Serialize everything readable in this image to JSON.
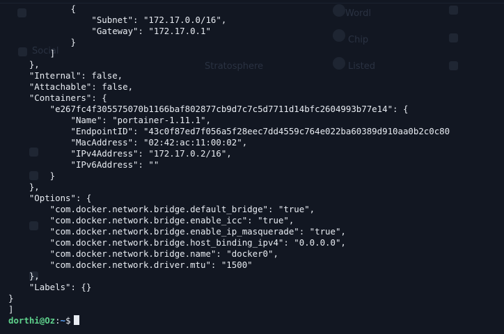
{
  "terminal": {
    "lines": [
      "            {",
      "                \"Subnet\": \"172.17.0.0/16\",",
      "                \"Gateway\": \"172.17.0.1\"",
      "            }",
      "        ]",
      "    },",
      "    \"Internal\": false,",
      "    \"Attachable\": false,",
      "    \"Containers\": {",
      "        \"e267fc4f305575070b1166baf802877cb9d7c7c5d7711d14bfc2604993b77e14\": {",
      "            \"Name\": \"portainer-1.11.1\",",
      "            \"EndpointID\": \"43c0f87ed7f056a5f28eec7dd4559c764e022ba60389d910aa0b2c0c80",
      "            \"MacAddress\": \"02:42:ac:11:00:02\",",
      "            \"IPv4Address\": \"172.17.0.2/16\",",
      "            \"IPv6Address\": \"\"",
      "        }",
      "    },",
      "    \"Options\": {",
      "        \"com.docker.network.bridge.default_bridge\": \"true\",",
      "        \"com.docker.network.bridge.enable_icc\": \"true\",",
      "        \"com.docker.network.bridge.enable_ip_masquerade\": \"true\",",
      "        \"com.docker.network.bridge.host_binding_ipv4\": \"0.0.0.0\",",
      "        \"com.docker.network.bridge.name\": \"docker0\",",
      "        \"com.docker.network.driver.mtu\": \"1500\"",
      "    },",
      "    \"Labels\": {}",
      "}",
      "]"
    ],
    "prompt": {
      "user_host": "dorthi@Oz",
      "separator": ":",
      "path": "~",
      "symbol": "$"
    }
  },
  "colors": {
    "background": "#121722",
    "text": "#e8ecf2",
    "prompt_user": "#5fd38d",
    "prompt_path": "#5ea8ff"
  },
  "background_page": {
    "ghost_labels": [
      "Social",
      "Wordl",
      "Chip",
      "Stratosphere",
      "Listed"
    ]
  }
}
